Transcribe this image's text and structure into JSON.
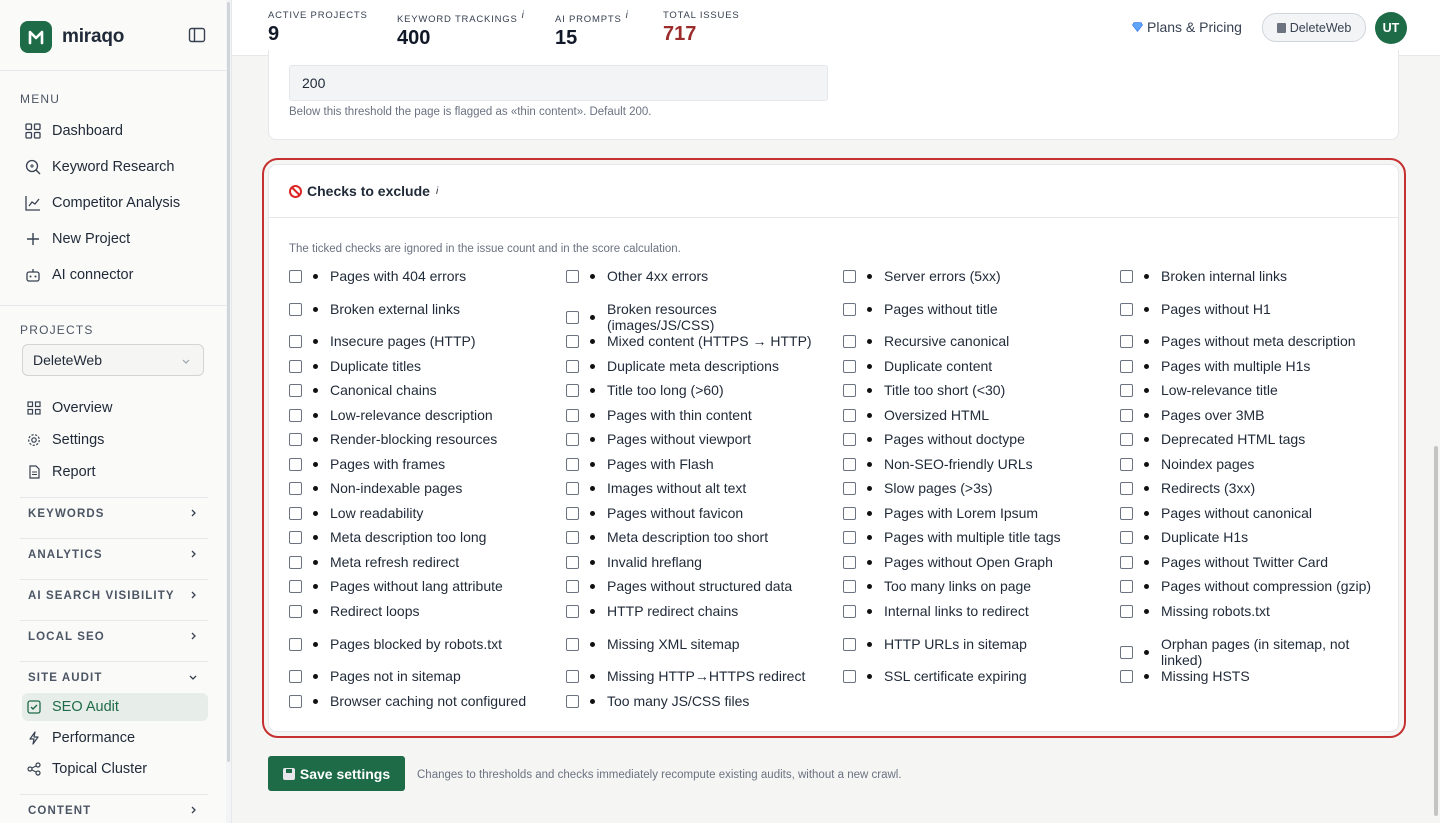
{
  "brand": {
    "name": "miraqo"
  },
  "sidebar": {
    "menu_title": "MENU",
    "menu": [
      {
        "label": "Dashboard",
        "icon": "grid-icon"
      },
      {
        "label": "Keyword Research",
        "icon": "search-icon"
      },
      {
        "label": "Competitor Analysis",
        "icon": "chart-line-icon"
      },
      {
        "label": "New Project",
        "icon": "plus-icon"
      },
      {
        "label": "AI connector",
        "icon": "robot-icon"
      }
    ],
    "projects_title": "PROJECTS",
    "project_selected": "DeleteWeb",
    "project_nav": [
      {
        "label": "Overview",
        "icon": "grid-icon"
      },
      {
        "label": "Settings",
        "icon": "gear-icon"
      },
      {
        "label": "Report",
        "icon": "document-icon"
      }
    ],
    "groups": [
      "KEYWORDS",
      "ANALYTICS",
      "AI SEARCH VISIBILITY",
      "LOCAL SEO",
      "SITE AUDIT"
    ],
    "site_audit_items": [
      {
        "label": "SEO Audit",
        "icon": "check-square-icon",
        "active": true
      },
      {
        "label": "Performance",
        "icon": "bolt-icon",
        "active": false
      },
      {
        "label": "Topical Cluster",
        "icon": "share-icon",
        "active": false
      }
    ],
    "content_group": "CONTENT"
  },
  "header": {
    "stats": [
      {
        "label": "ACTIVE PROJECTS",
        "value": "9",
        "info": ""
      },
      {
        "label": "KEYWORD TRACKINGS",
        "value": "400",
        "info": "i"
      },
      {
        "label": "AI PROMPTS",
        "value": "15",
        "info": "i"
      },
      {
        "label": "TOTAL ISSUES",
        "value": "717",
        "info": ""
      }
    ],
    "plans_label": "Plans & Pricing",
    "project_pill": "DeleteWeb",
    "avatar_initials": "UT"
  },
  "threshold": {
    "value": "200",
    "help": "Below this threshold the page is flagged as «thin content». Default 200."
  },
  "checks": {
    "title": "Checks to exclude",
    "info": "i",
    "description": "The ticked checks are ignored in the issue count and in the score calculation.",
    "rows": [
      [
        "Pages with 404 errors",
        "Other 4xx errors",
        "Server errors (5xx)",
        "Broken internal links"
      ],
      [
        "Broken external links",
        "Broken resources (images/JS/CSS)",
        "Pages without title",
        "Pages without H1"
      ],
      [
        "Insecure pages (HTTP)",
        "Mixed content (HTTPS → HTTP)",
        "Recursive canonical",
        "Pages without meta description"
      ],
      [
        "Duplicate titles",
        "Duplicate meta descriptions",
        "Duplicate content",
        "Pages with multiple H1s"
      ],
      [
        "Canonical chains",
        "Title too long (>60)",
        "Title too short (<30)",
        "Low-relevance title"
      ],
      [
        "Low-relevance description",
        "Pages with thin content",
        "Oversized HTML",
        "Pages over 3MB"
      ],
      [
        "Render-blocking resources",
        "Pages without viewport",
        "Pages without doctype",
        "Deprecated HTML tags"
      ],
      [
        "Pages with frames",
        "Pages with Flash",
        "Non-SEO-friendly URLs",
        "Noindex pages"
      ],
      [
        "Non-indexable pages",
        "Images without alt text",
        "Slow pages (>3s)",
        "Redirects (3xx)"
      ],
      [
        "Low readability",
        "Pages without favicon",
        "Pages with Lorem Ipsum",
        "Pages without canonical"
      ],
      [
        "Meta description too long",
        "Meta description too short",
        "Pages with multiple title tags",
        "Duplicate H1s"
      ],
      [
        "Meta refresh redirect",
        "Invalid hreflang",
        "Pages without Open Graph",
        "Pages without Twitter Card"
      ],
      [
        "Pages without lang attribute",
        "Pages without structured data",
        "Too many links on page",
        "Pages without compression (gzip)"
      ],
      [
        "Redirect loops",
        "HTTP redirect chains",
        "Internal links to redirect",
        "Missing robots.txt"
      ],
      [
        "Pages blocked by robots.txt",
        "Missing XML sitemap",
        "HTTP URLs in sitemap",
        "Orphan pages (in sitemap, not linked)"
      ],
      [
        "Pages not in sitemap",
        "Missing HTTP→HTTPS redirect",
        "SSL certificate expiring",
        "Missing HSTS"
      ],
      [
        "Browser caching not configured",
        "Too many JS/CSS files",
        "",
        ""
      ]
    ]
  },
  "footer": {
    "save_label": "Save settings",
    "save_help": "Changes to thresholds and checks immediately recompute existing audits, without a new crawl."
  },
  "colors": {
    "brand_green": "#1d6b47",
    "issues_red": "#9b2c2c",
    "highlight_red": "#c53030"
  }
}
